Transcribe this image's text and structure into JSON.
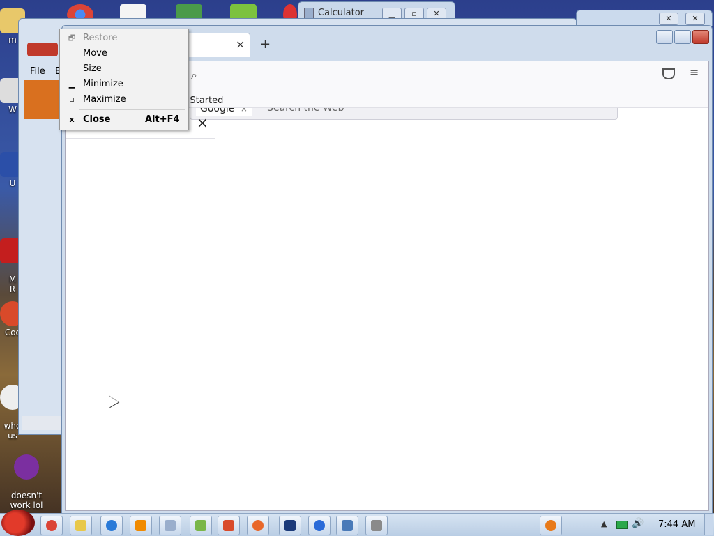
{
  "desktop_icons": [
    {
      "name": "desktop-icon-m",
      "label": "m"
    },
    {
      "name": "desktop-icon-w",
      "label": "W"
    },
    {
      "name": "desktop-icon-u",
      "label": "U"
    },
    {
      "name": "desktop-icon-mr",
      "label": "M\nR"
    },
    {
      "name": "desktop-icon-coc",
      "label": "Coc"
    },
    {
      "name": "desktop-icon-who",
      "label": "who\nus"
    },
    {
      "name": "desktop-icon-yahoo",
      "label": "doesn't\nwork lol"
    }
  ],
  "calculator": {
    "title": "Calculator"
  },
  "browser": {
    "menubar": {
      "file": "File",
      "edit": "E"
    },
    "tab": {
      "close": "×",
      "new_tab": "+"
    },
    "search": {
      "engine": "Google",
      "engine_clear": "×",
      "placeholder": "Search the Web"
    },
    "bookmark": "g Started",
    "sidebar_close": "×"
  },
  "context_menu": {
    "items": [
      {
        "label": "Restore",
        "symbol": "🗗",
        "disabled": true
      },
      {
        "label": "Move",
        "symbol": "",
        "disabled": false
      },
      {
        "label": "Size",
        "symbol": "",
        "disabled": false
      },
      {
        "label": "Minimize",
        "symbol": "▁",
        "disabled": false
      },
      {
        "label": "Maximize",
        "symbol": "▫",
        "disabled": false
      },
      {
        "label": "Close",
        "symbol": "x",
        "shortcut": "Alt+F4",
        "disabled": false
      }
    ]
  },
  "taskbar": {
    "clock": "7:44 AM"
  },
  "colors": {
    "accent": "#2c3f8c",
    "close": "#c0392b"
  }
}
